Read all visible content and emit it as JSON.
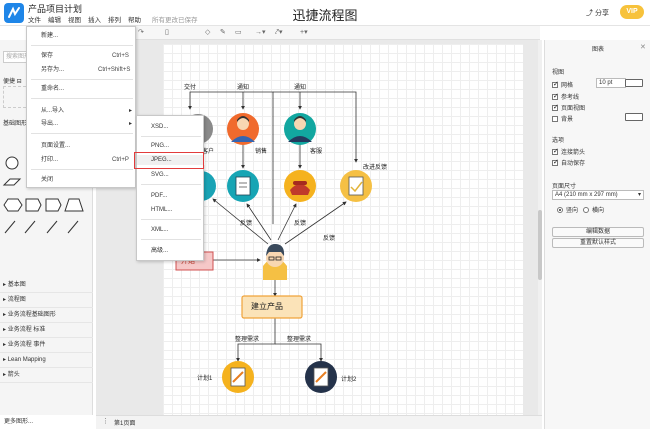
{
  "app": {
    "doc_title": "产品项目计划",
    "title": "迅捷流程图",
    "share": "分享",
    "vip": "VIP",
    "saved_note": "所有更改已保存"
  },
  "menubar": [
    "文件",
    "编辑",
    "视图",
    "插入",
    "排列",
    "帮助"
  ],
  "file_menu": {
    "items": [
      {
        "label": "新建..."
      },
      {
        "label": "保存",
        "shortcut": "Ctrl+S"
      },
      {
        "label": "另存为...",
        "shortcut": "Ctrl+Shift+S"
      },
      {
        "label": "重命名..."
      },
      {
        "label": "从...导入"
      },
      {
        "label": "导出..."
      },
      {
        "label": "页面设置..."
      },
      {
        "label": "打印...",
        "shortcut": "Ctrl+P"
      },
      {
        "label": "关闭"
      }
    ]
  },
  "export_menu": {
    "items": [
      "XSD...",
      "PNG...",
      "JPEG...",
      "SVG...",
      "PDF...",
      "HTML...",
      "XML...",
      "高级..."
    ],
    "selected": "JPEG..."
  },
  "left_panel": {
    "search_placeholder": "搜索图形",
    "section_favorites": "便捷 ⊟",
    "section_basic": "基础图形",
    "libraries": [
      "基本图",
      "流程图",
      "业务流程基础图形",
      "业务流程 标准",
      "业务流程 事件",
      "Lean Mapping",
      "箭头"
    ],
    "more_shapes": "更多图形..."
  },
  "bottom": {
    "page_tab": "第1页面"
  },
  "right_panel": {
    "title": "图表",
    "view_head": "视图",
    "grid": "网格",
    "grid_size": "10",
    "grid_unit": "pt",
    "guides": "参考线",
    "page_view": "页面视图",
    "background": "背景",
    "options_head": "选项",
    "connect_arrows": "连接箭头",
    "auto_save": "自动保存",
    "paper_size_head": "页面尺寸",
    "paper_size": "A4 (210 mm x 297 mm)",
    "portrait": "竖向",
    "landscape": "横向",
    "edit_data": "编辑数据",
    "reset_style": "重置默认样式"
  },
  "diagram": {
    "top_labels": [
      "交付",
      "通知",
      "通知"
    ],
    "sales": "销售",
    "customer_service": "客服",
    "client": "客户",
    "feedback": "反馈",
    "improve_feedback": "改进反馈",
    "start": "开始",
    "build_product": "建立产品",
    "organize_needs": "整理需求",
    "plan1": "计划1",
    "plan2": "计划2"
  },
  "colors": {
    "accent": "#1f86e8",
    "highlight": "#e23b3b",
    "product_box": "#fbe3b8"
  }
}
